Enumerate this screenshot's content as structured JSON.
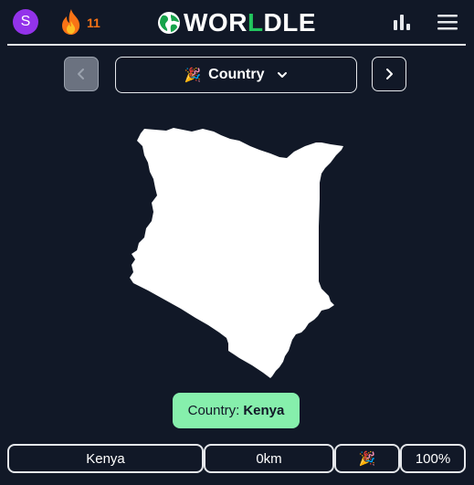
{
  "header": {
    "avatar_initial": "S",
    "streak_count": "11",
    "logo": {
      "part1": "WOR",
      "part2": "L",
      "part3": "DLE"
    },
    "icons": {
      "streak": "flame-icon",
      "globe": "globe-icon",
      "stats": "bar-chart-icon",
      "menu": "hamburger-menu-icon"
    }
  },
  "category": {
    "emoji": "🎉",
    "label": "Country",
    "prev_icon": "chevron-left-icon",
    "next_icon": "chevron-right-icon",
    "dropdown_icon": "chevron-down-icon"
  },
  "result": {
    "prefix": "Country:",
    "answer": "Kenya"
  },
  "guess": {
    "country": "Kenya",
    "distance": "0km",
    "direction": "🎉",
    "percent": "100%"
  },
  "colors": {
    "background": "#111827",
    "accent_green": "#22c55e",
    "result_bg": "#86efac",
    "streak": "#f97316",
    "avatar": "#9333ea"
  }
}
